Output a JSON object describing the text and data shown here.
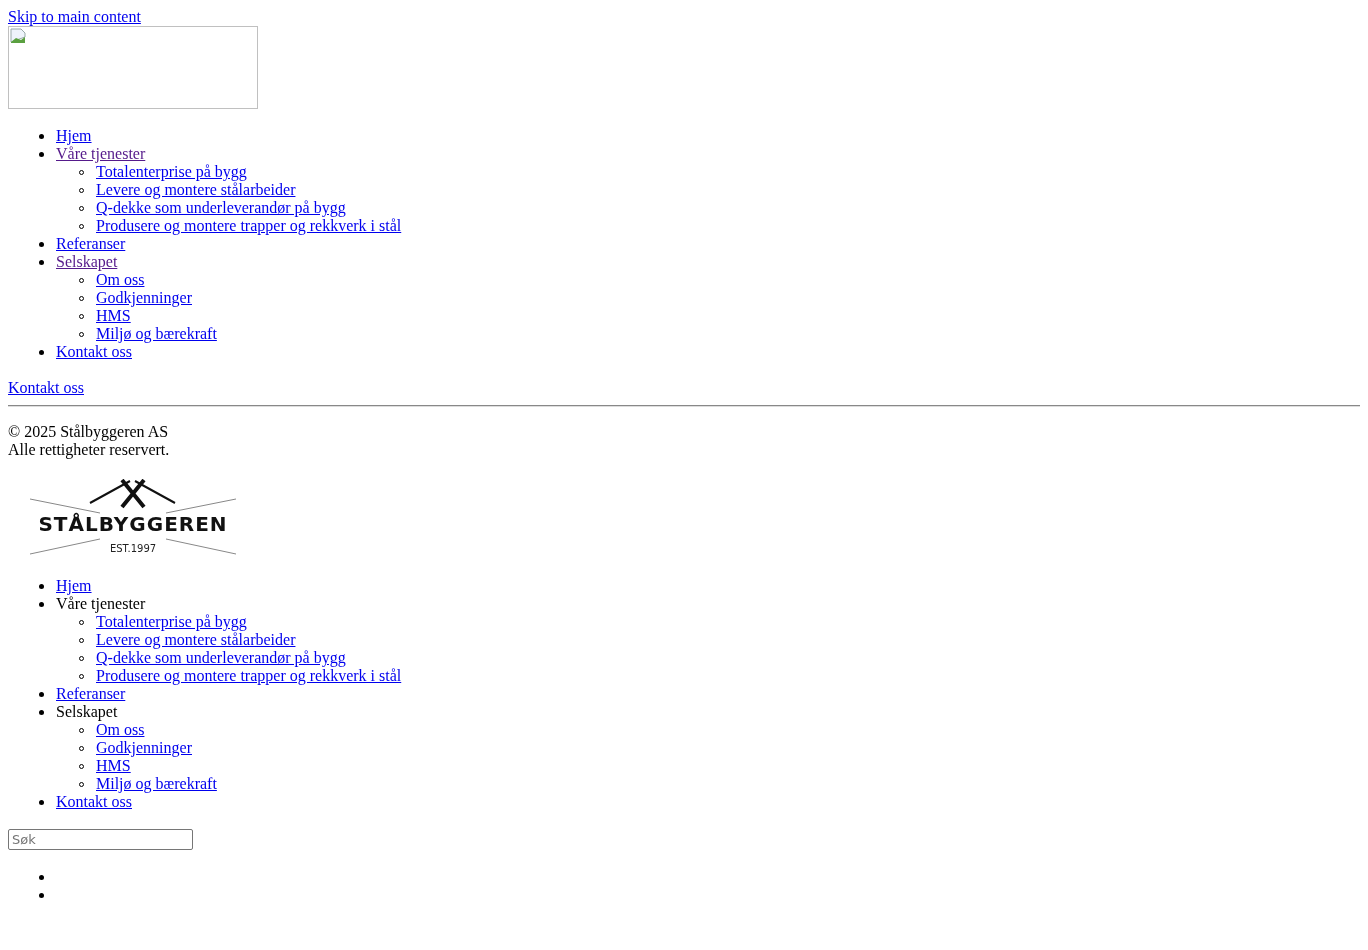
{
  "skip_link": {
    "label": "Skip to main content",
    "visited": false
  },
  "header_image": {
    "broken": true
  },
  "header_nav": [
    {
      "label": "Hjem",
      "kind": "link",
      "visited": false
    },
    {
      "label": "Våre tjenester",
      "kind": "link",
      "visited": true,
      "children": [
        {
          "label": "Totalenterprise på bygg",
          "kind": "link",
          "visited": false
        },
        {
          "label": "Levere og montere stålarbeider",
          "kind": "link",
          "visited": false
        },
        {
          "label": "Q-dekke som underleverandør på bygg",
          "kind": "link",
          "visited": false
        },
        {
          "label": "Produsere og montere trapper og rekkverk i stål",
          "kind": "link",
          "visited": false
        }
      ]
    },
    {
      "label": "Referanser",
      "kind": "link",
      "visited": false
    },
    {
      "label": "Selskapet",
      "kind": "link",
      "visited": true,
      "children": [
        {
          "label": "Om oss",
          "kind": "link",
          "visited": false
        },
        {
          "label": "Godkjenninger",
          "kind": "link",
          "visited": false
        },
        {
          "label": "HMS",
          "kind": "link",
          "visited": false
        },
        {
          "label": "Miljø og bærekraft",
          "kind": "link",
          "visited": false
        }
      ]
    },
    {
      "label": "Kontakt oss",
      "kind": "link",
      "visited": false
    }
  ],
  "contact_link": {
    "label": "Kontakt oss",
    "visited": false
  },
  "copyright": [
    "© 2025 Stålbyggeren AS",
    "Alle rettigheter reservert."
  ],
  "logo": {
    "name": "STÅLBYGGEREN",
    "established": "EST.1997"
  },
  "footer_nav": [
    {
      "label": "Hjem",
      "kind": "link",
      "visited": false
    },
    {
      "label": "Våre tjenester",
      "kind": "text",
      "children": [
        {
          "label": "Totalenterprise på bygg",
          "kind": "link",
          "visited": false
        },
        {
          "label": "Levere og montere stålarbeider",
          "kind": "link",
          "visited": false
        },
        {
          "label": "Q-dekke som underleverandør på bygg",
          "kind": "link",
          "visited": false
        },
        {
          "label": "Produsere og montere trapper og rekkverk i stål",
          "kind": "link",
          "visited": false
        }
      ]
    },
    {
      "label": "Referanser",
      "kind": "link",
      "visited": false
    },
    {
      "label": "Selskapet",
      "kind": "text",
      "children": [
        {
          "label": "Om oss",
          "kind": "link",
          "visited": false
        },
        {
          "label": "Godkjenninger",
          "kind": "link",
          "visited": false
        },
        {
          "label": "HMS",
          "kind": "link",
          "visited": false
        },
        {
          "label": "Miljø og bærekraft",
          "kind": "link",
          "visited": false
        }
      ]
    },
    {
      "label": "Kontakt oss",
      "kind": "link",
      "visited": false
    }
  ],
  "search": {
    "placeholder": "Søk"
  },
  "bottom_list": [
    {
      "kind": "empty"
    },
    {
      "kind": "empty"
    }
  ]
}
